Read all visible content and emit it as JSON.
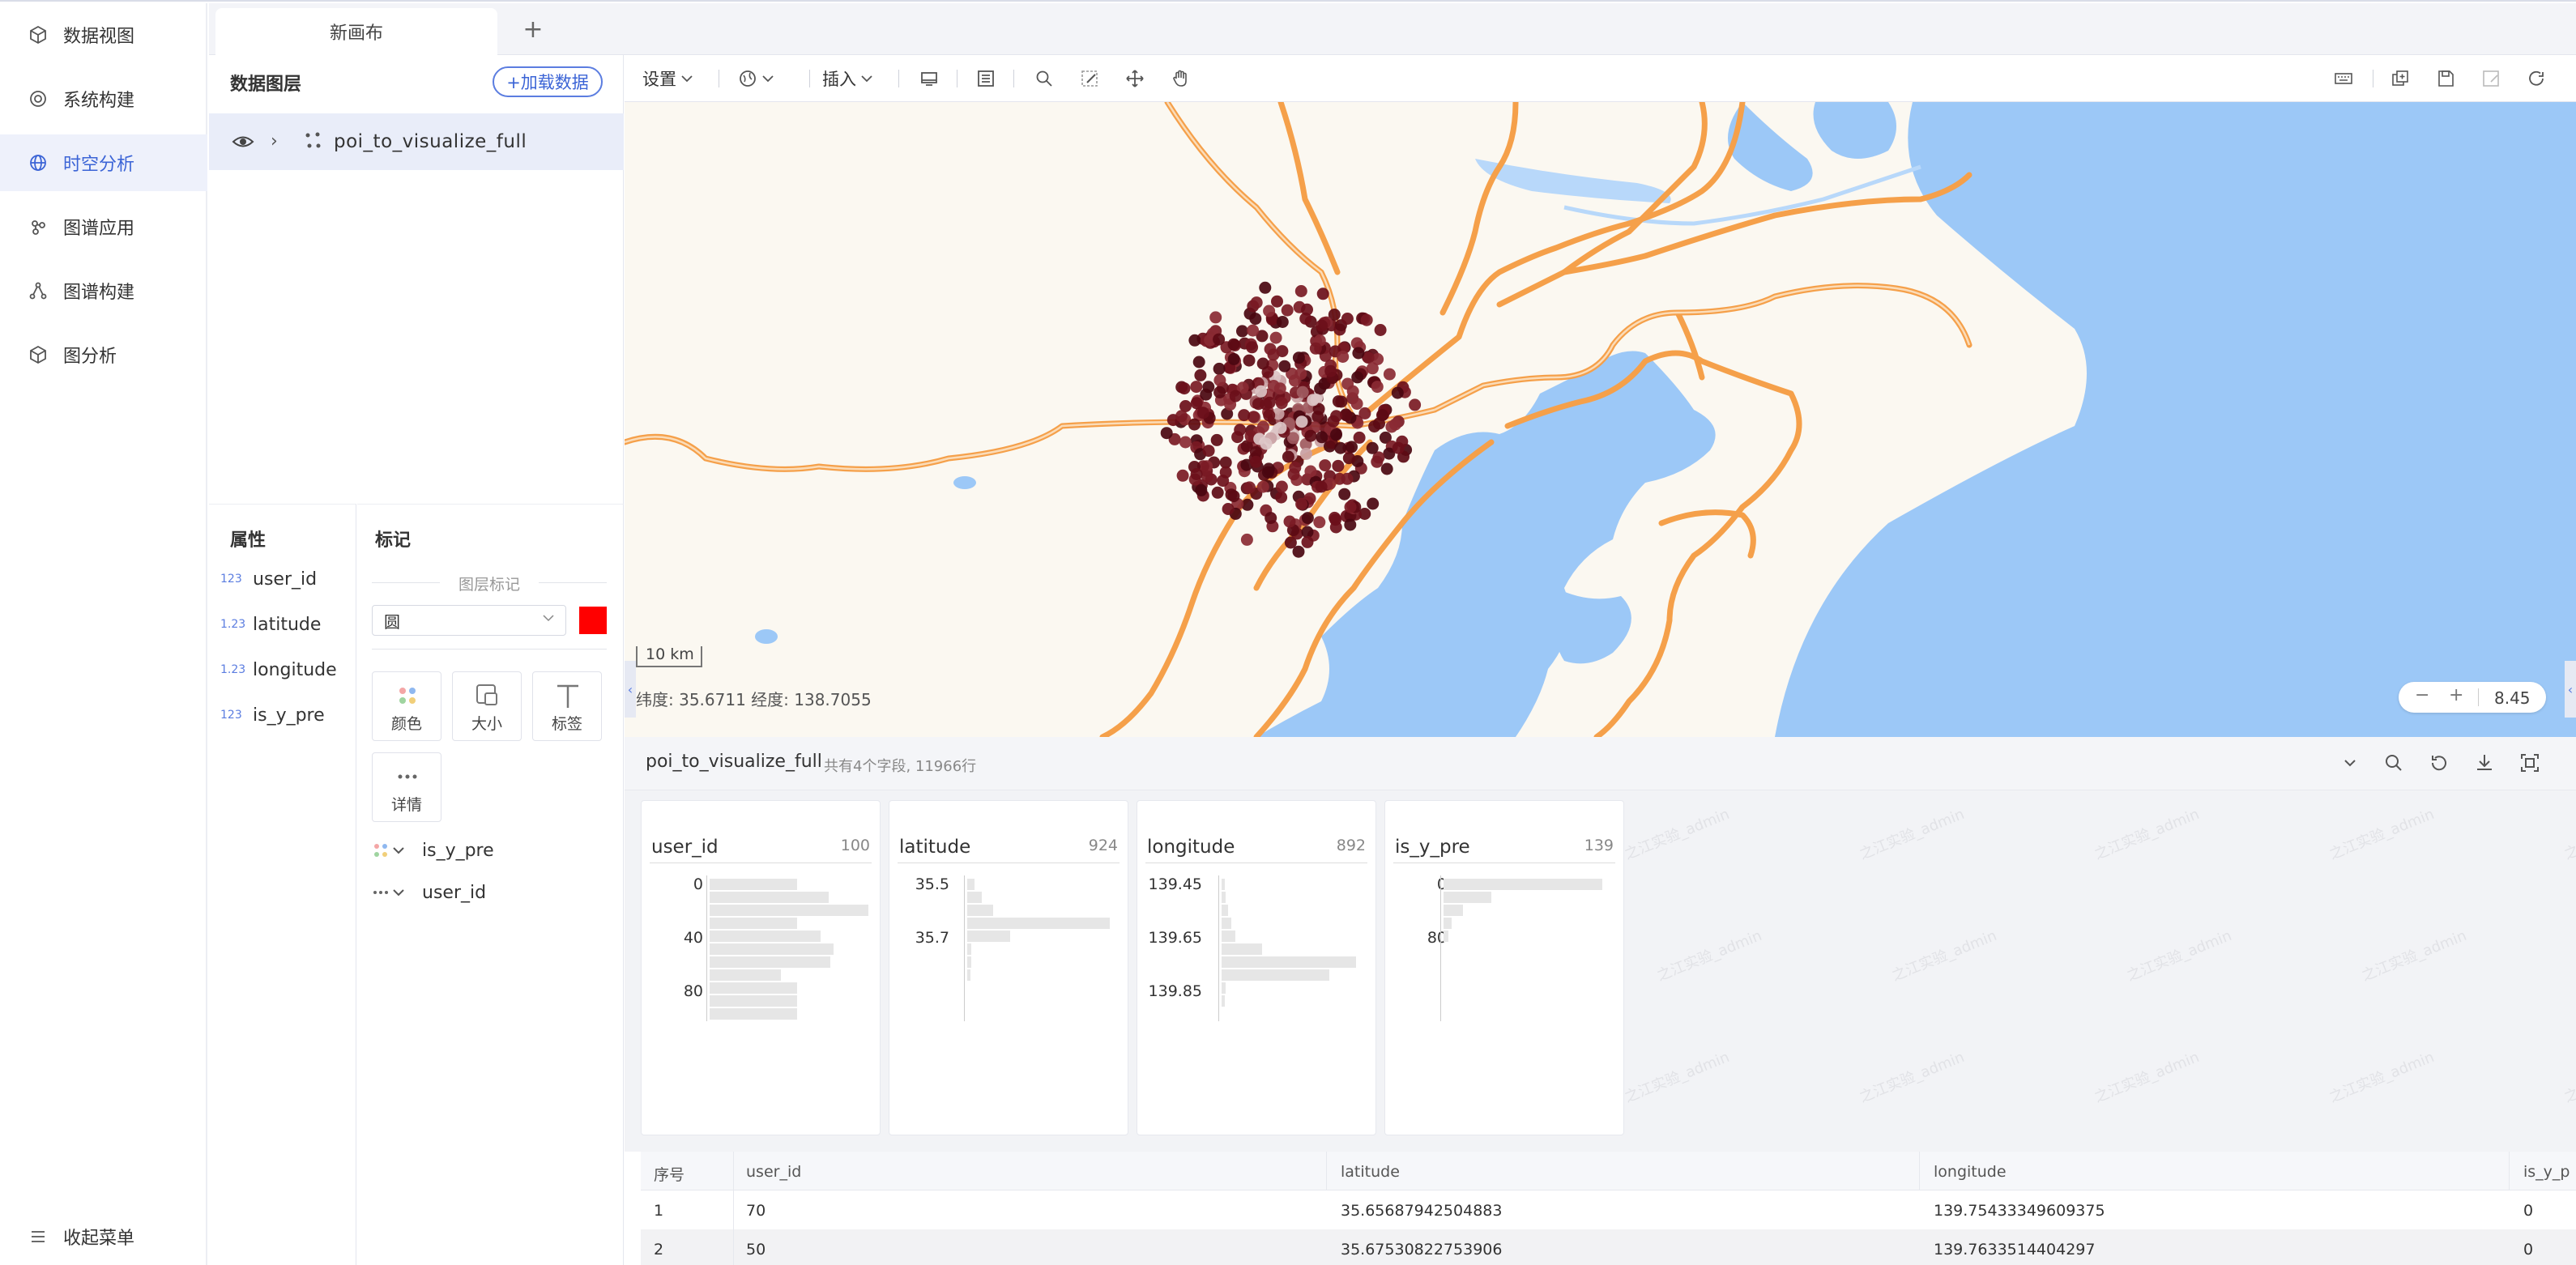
{
  "nav": {
    "items": [
      {
        "label": "数据视图",
        "icon": "cube-icon",
        "active": false
      },
      {
        "label": "系统构建",
        "icon": "target-icon",
        "active": false
      },
      {
        "label": "时空分析",
        "icon": "globe-icon",
        "active": true
      },
      {
        "label": "图谱应用",
        "icon": "graph-app-icon",
        "active": false
      },
      {
        "label": "图谱构建",
        "icon": "graph-build-icon",
        "active": false
      },
      {
        "label": "图分析",
        "icon": "graph-analysis-icon",
        "active": false
      }
    ],
    "collapse_label": "收起菜单",
    "accent": "#3b64d6"
  },
  "tabs": {
    "canvas_tab": "新画布",
    "add_label": "+"
  },
  "layers": {
    "title": "数据图层",
    "load_button": "+加载数据",
    "layer_name": "poi_to_visualize_full"
  },
  "attributes": {
    "title": "属性",
    "fields": [
      {
        "type": "123",
        "name": "user_id"
      },
      {
        "type": "1.23",
        "name": "latitude"
      },
      {
        "type": "1.23",
        "name": "longitude"
      },
      {
        "type": "123",
        "name": "is_y_pre"
      }
    ]
  },
  "marks": {
    "title": "标记",
    "layer_mark_label": "图层标记",
    "shape_value": "圆",
    "mark_color": "#ff0000",
    "buttons": [
      "颜色",
      "大小",
      "标签",
      "详情"
    ],
    "encodings": [
      {
        "icon": "color-dots-icon",
        "field": "is_y_pre"
      },
      {
        "icon": "detail-dots-icon",
        "field": "user_id"
      }
    ]
  },
  "toolbar": {
    "settings_label": "设置",
    "insert_label": "插入"
  },
  "map": {
    "scale_label": "10 km",
    "coord_readout": "纬度: 35.6711 经度: 138.7055",
    "zoom_minus": "−",
    "zoom_plus": "+",
    "zoom_level": "8.45",
    "water_color": "#9cc8f7",
    "land_color": "#fbf8f1",
    "road_color": "#f5a04a",
    "point_color": "#6b0f1a"
  },
  "data_panel": {
    "dataset_name": "poi_to_visualize_full",
    "meta": "共有4个字段, 11966行",
    "watermark": "之江实验_admin",
    "fields": [
      {
        "name": "user_id",
        "count": "100",
        "ticks": [
          "0",
          "40",
          "80"
        ],
        "bars": [
          0.55,
          0.75,
          1.0,
          0.55,
          0.7,
          0.78,
          0.76,
          0.45,
          0.55,
          0.55,
          0.55
        ]
      },
      {
        "name": "latitude",
        "count": "924",
        "ticks": [
          "35.5",
          "35.7"
        ],
        "bars": [
          0.05,
          0.1,
          0.18,
          1.0,
          0.3,
          0.03,
          0.03,
          0.02
        ]
      },
      {
        "name": "longitude",
        "count": "892",
        "ticks": [
          "139.45",
          "139.65",
          "139.85"
        ],
        "bars": [
          0.02,
          0.03,
          0.05,
          0.07,
          0.1,
          0.3,
          1.0,
          0.8,
          0.03,
          0.02
        ]
      },
      {
        "name": "is_y_pre",
        "count": "139",
        "ticks": [
          "0",
          "80"
        ],
        "bars": [
          1.0,
          0.3,
          0.12,
          0.05,
          0.03
        ]
      }
    ]
  },
  "table": {
    "columns": [
      "序号",
      "user_id",
      "latitude",
      "longitude",
      "is_y_p"
    ],
    "rows": [
      [
        "1",
        "70",
        "35.65687942504883",
        "139.75433349609375",
        "0"
      ],
      [
        "2",
        "50",
        "35.67530822753906",
        "139.7633514404297",
        "0"
      ]
    ]
  }
}
